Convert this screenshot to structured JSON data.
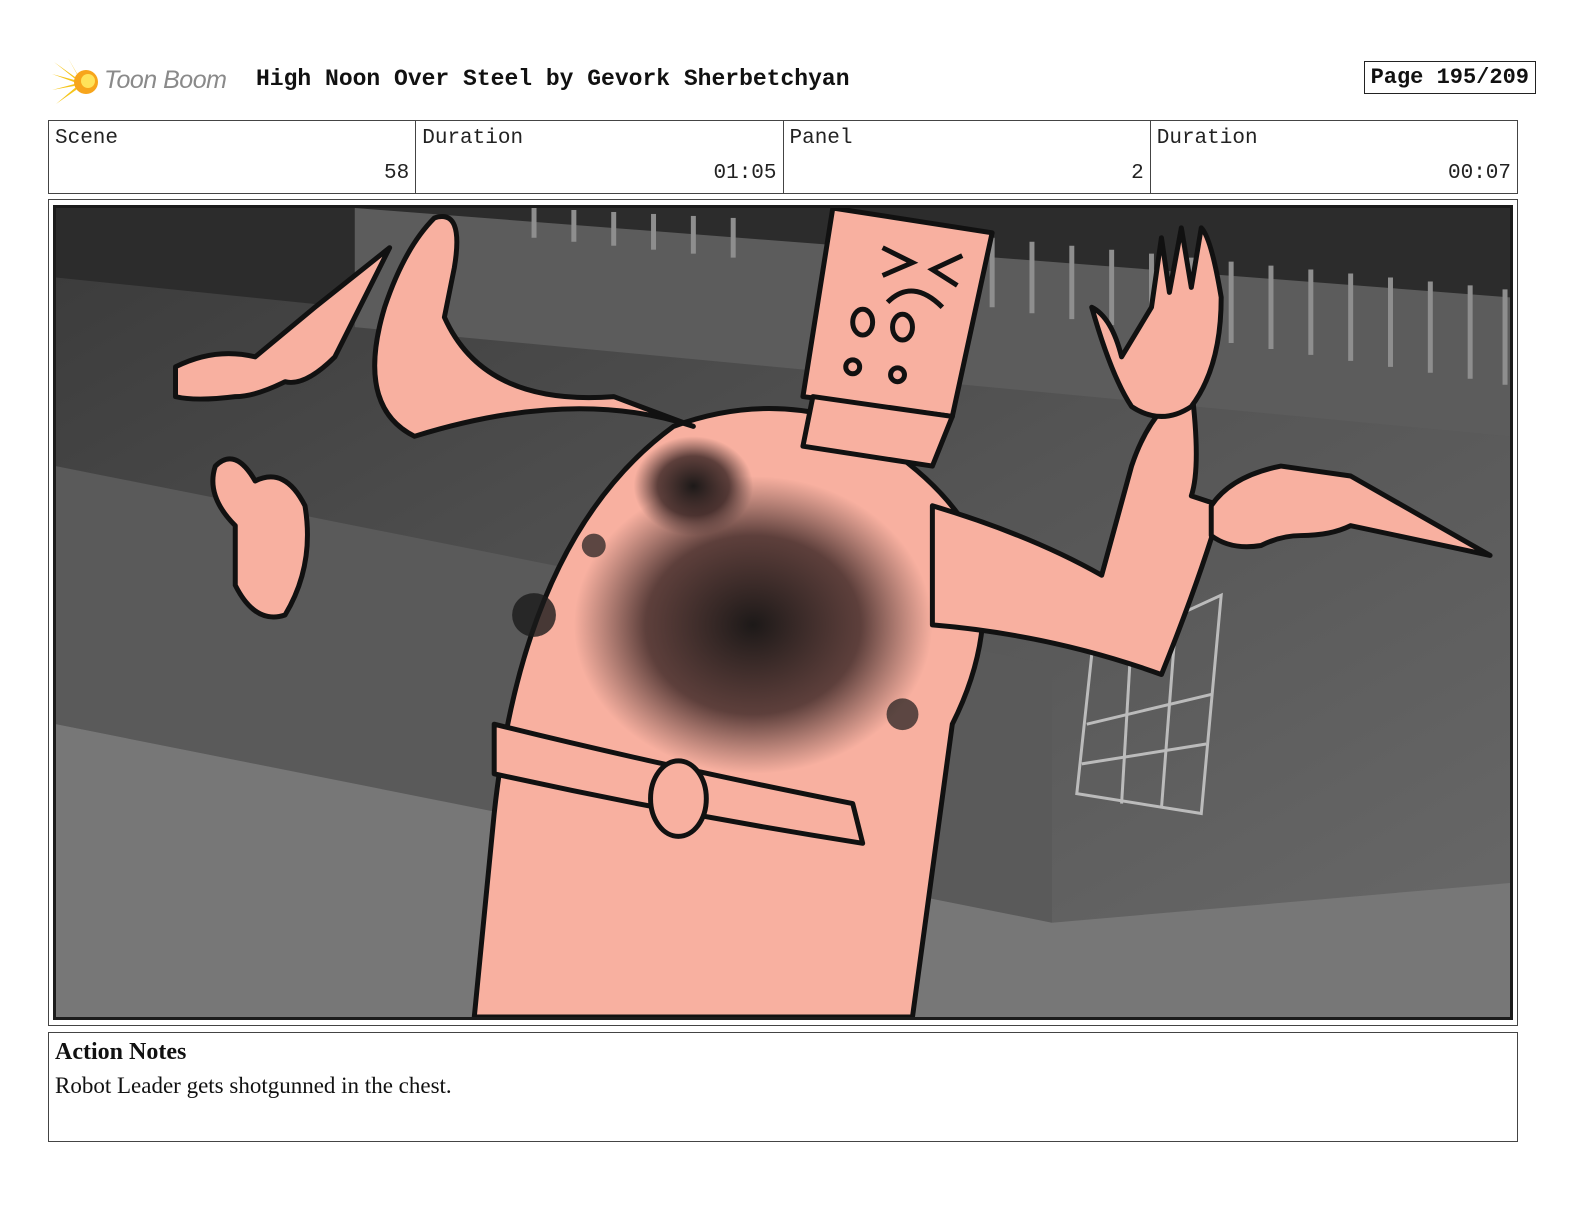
{
  "header": {
    "logo_text": "Toon Boom",
    "title": "High Noon Over Steel by Gevork Sherbetchyan",
    "page": "Page 195/209"
  },
  "info": {
    "scene_label": "Scene",
    "scene_value": "58",
    "scene_duration_label": "Duration",
    "scene_duration_value": "01:05",
    "panel_label": "Panel",
    "panel_value": "2",
    "panel_duration_label": "Duration",
    "panel_duration_value": "00:07"
  },
  "panel": {
    "skin_color": "#f8b0a0",
    "line_color": "#111111",
    "frame_color": "#1c1c1c"
  },
  "notes": {
    "title": "Action Notes",
    "text": "Robot Leader gets shotgunned in the chest."
  }
}
